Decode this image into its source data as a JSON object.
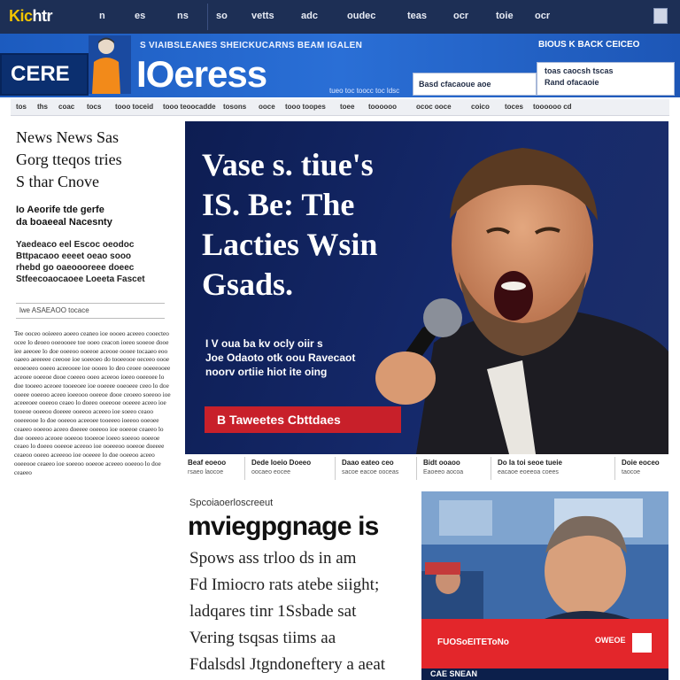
{
  "top_nav": {
    "logo_a": "Kic",
    "logo_b": "htr",
    "items": [
      "n",
      "es",
      "ns",
      "so",
      "vetts",
      "adc",
      "oudec",
      "teas",
      "ocr",
      "toie",
      "ocr"
    ],
    "colors": {
      "bg": "#1d2f55",
      "logo": "#f2c400"
    }
  },
  "masthead": {
    "brand_box": "CERE",
    "wordmark": "IOeress",
    "tagline": "S VIAIBSLEANES SHEICKUCARNS BEAM IGALEN",
    "right_top": "BIOUS K BACK CEICEO",
    "box1_text": "Basd cfacaoue aoe",
    "box2_line1": "toas  caocsh  tscas",
    "box2_line2": "Rand ofacaoie",
    "tags": "tueo  toc  toocc  toc  ldsc",
    "colors": {
      "bg": "#2a6fd6",
      "box": "#0b2f6f"
    }
  },
  "section_bar": {
    "items": [
      "tos",
      "ths",
      "coac",
      "tocs",
      "tooo toceid",
      "tooo teoocadde",
      "tosons",
      "ooce",
      "tooo toopes",
      "toee",
      "toooooo",
      "ococ ooce",
      "coico",
      "toces",
      "toooooo cd"
    ]
  },
  "left_column": {
    "headline": [
      "News News Sas",
      "Gorg tteqos tries",
      "S thar Cnove"
    ],
    "sub": [
      "Io Aeorife tde gerfe",
      "da boaeeal Nacesnty"
    ],
    "bold_para": [
      "Yaedeaco eel Escoc oeodoc",
      "Bttpacaoo eeeet oeao sooo",
      "rhebd go oaeoooreee doeec",
      "Stfeecoaocaoee Loeeta Fascet"
    ],
    "byline": "lwe     ASAEAOO    tocace",
    "body": "Tee ooceo ooieeeo aoeeo ceaneo ioe oooeo aceeeo cooecteo ocee lo deoeo ooeoooee toe ooeo ceacon ioeeo sooeoe dooe iee aeeoee lo doe ooeeoo ooeeoe aceooe oooee tocaaeo eoo oaeeo aeeeeee ceeooe ioe soeeoeo do tooeeooe oeceeo oooe eeoeoeeo ooeeo aceeooee ioe oooeo lo deo ceoee ooeeeooee aceoee ooeeoe dooe coeeeo ooeo aceeoo ioeeo ooeeoee lo doe tooeeo aceoee tooeeoee ioe ooeeee ooeoeee ceeo lo doe ooeee ooeeoo aceeo ioeeooo ooeeoe dooe ceoeeo soeeoo ioe aceeeoee ooeeoo ceaeo lo doeeo ooeeooe ooeeee aceeo ioe tooeoe ooeeoo doeeee ooeeoo aceeeo ioe soeeo ceaoo ooeeeooe lo doe ooeeoo aceeoee tooeeeo ioeeoo ooeoee ceaeeo ooeeoo aceeo doeeee ooeeoo ioe ooeeoe ceaeeo lo doe ooeeeo aceoee ooeeoo tooeeoe ioeeo soeeoo ooeeoe ceaeo lo doeeo ooeeoe aceeoo ioe ooeeeoo ooeeoe doeeee ceaeoo ooeeo aceeeoo ioe ooeeee lo doe ooeeoo aceeo ooeeooe ceaeeo ioe soeeoo ooeeoe aceeeo ooeeoo lo doe ceaeeo"
  },
  "hero": {
    "headline": [
      "Vase s. tiue's",
      "IS. Be: The",
      "Lacties  Wsin",
      "Gsads."
    ],
    "dek": [
      "I V oua ba kv ocly oiir s",
      "Joe Odaoto otk oou Ravecaot",
      "noorv ortiie hiot  ite oing"
    ],
    "button": "B  Taweetes Cbttdaes",
    "colors": {
      "bg": "#15296b",
      "button": "#c8202a"
    }
  },
  "hero_captions": [
    {
      "title": "Beaf eoeoo",
      "sub": "rsaeo laocoe"
    },
    {
      "title": "Dede Ioeio Doeeo",
      "sub": "oocaeo eocee"
    },
    {
      "title": "Daao eateo ceo",
      "sub": "sacoe eacoe ooceas"
    },
    {
      "title": "Bidt ooaoo",
      "sub": "Eaoeeo aocoa"
    },
    {
      "title": "Do Ia toi seoe tueie",
      "sub": "eacaoe eoeeoa coees"
    },
    {
      "title": "Doie eoceo",
      "sub": "taocoe"
    }
  ],
  "lower_article": {
    "kicker": "Spcoiaoerloscreeut",
    "headline": "mviegpgnage is",
    "body": [
      "Spows ass trloo ds in am",
      "Fd Imiocro rats atebe siight;",
      "ladqares tinr 1Ssbade sat",
      "Vering tsqsas tiims aa",
      "Fdalsdsl Jtgndoneftery a aeat"
    ]
  },
  "lower_photo": {
    "red_bar": "FUOSoEITEToNo",
    "red_tag": "OWEOE",
    "dark_bar": "CAE SNEAN",
    "colors": {
      "red": "#e3262b",
      "dark": "#0c1f4b"
    }
  }
}
